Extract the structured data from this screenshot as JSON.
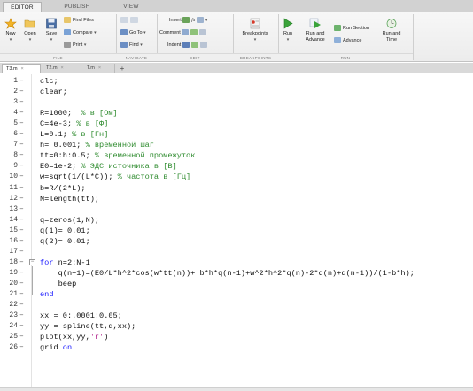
{
  "tabs": [
    {
      "label": "EDITOR",
      "active": true
    },
    {
      "label": "PUBLISH",
      "active": false
    },
    {
      "label": "VIEW",
      "active": false
    }
  ],
  "toolstrip": {
    "file": {
      "group_label": "FILE",
      "new_label": "New",
      "open_label": "Open",
      "save_label": "Save",
      "find_files_label": "Find Files",
      "compare_label": "Compare",
      "print_label": "Print"
    },
    "navigate": {
      "group_label": "NAVIGATE",
      "goto_label": "Go To",
      "find_label": "Find"
    },
    "edit": {
      "group_label": "EDIT",
      "insert_label": "Insert",
      "comment_label": "Comment",
      "indent_label": "Indent",
      "fx_label": "fx"
    },
    "breakpoints": {
      "group_label": "BREAKPOINTS",
      "breakpoints_label": "Breakpoints"
    },
    "run": {
      "group_label": "RUN",
      "run_label": "Run",
      "run_advance_label": "Run and Advance",
      "run_section_label": "Run Section",
      "advance_label": "Advance",
      "run_time_label": "Run and Time"
    }
  },
  "document_tabs": [
    {
      "label": "T3.m",
      "active": true
    },
    {
      "label": "T2.m",
      "active": false
    },
    {
      "label": "T.m",
      "active": false
    }
  ],
  "add_tab_label": "+",
  "close_glyph": "×",
  "colors": {
    "keyword": "#1a1aff",
    "comment": "#2e8b2e",
    "string": "#b0208a"
  },
  "code_lines": [
    {
      "n": "1",
      "text": "clc;"
    },
    {
      "n": "2",
      "text": "clear;"
    },
    {
      "n": "3",
      "text": ""
    },
    {
      "n": "4",
      "code": "R=1000;  ",
      "comment": "% в [Ом]"
    },
    {
      "n": "5",
      "code": "C=4e-3; ",
      "comment": "% в [Ф]"
    },
    {
      "n": "6",
      "code": "L=0.1; ",
      "comment": "% в [Гн]"
    },
    {
      "n": "7",
      "code": "h= 0.001; ",
      "comment": "% временной шаг"
    },
    {
      "n": "8",
      "code": "tt=0:h:0.5; ",
      "comment": "% временной промежуток"
    },
    {
      "n": "9",
      "code": "E0=1e-2; ",
      "comment": "% ЭДС источника в [В]"
    },
    {
      "n": "10",
      "code": "w=sqrt(1/(L*C)); ",
      "comment": "% частота в [Гц]"
    },
    {
      "n": "11",
      "text": "b=R/(2*L);"
    },
    {
      "n": "12",
      "text": "N=length(tt);"
    },
    {
      "n": "13",
      "text": ""
    },
    {
      "n": "14",
      "text": "q=zeros(1,N);"
    },
    {
      "n": "15",
      "text": "q(1)= 0.01;"
    },
    {
      "n": "16",
      "text": "q(2)= 0.01;"
    },
    {
      "n": "17",
      "text": ""
    },
    {
      "n": "18",
      "keyword": "for",
      "code": " n=2:N-1"
    },
    {
      "n": "19",
      "text": "    q(n+1)=(E0/L*h^2*cos(w*tt(n))+ b*h*q(n-1)+w^2*h^2*q(n)-2*q(n)+q(n-1))/(1-b*h);"
    },
    {
      "n": "20",
      "text": "    beep"
    },
    {
      "n": "21",
      "keyword": "end",
      "code": ""
    },
    {
      "n": "22",
      "text": ""
    },
    {
      "n": "23",
      "text": "xx = 0:.0001:0.05;"
    },
    {
      "n": "24",
      "text": "yy = spline(tt,q,xx);"
    },
    {
      "n": "25",
      "code": "plot(xx,yy,",
      "string": "'r'",
      "tail": ")"
    },
    {
      "n": "26",
      "code": "grid ",
      "keyword_tail": "on"
    }
  ]
}
